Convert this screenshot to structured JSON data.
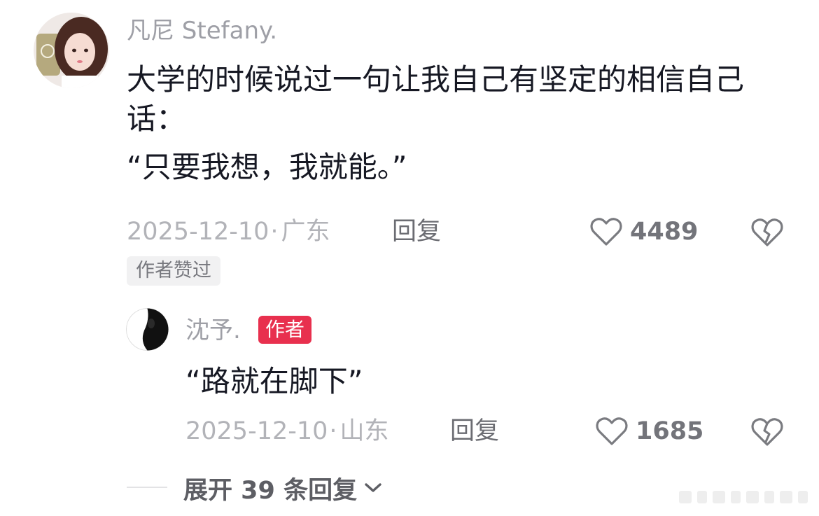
{
  "comment": {
    "author_name": "凡尼 Stefany.",
    "text_line1": "大学的时候说过一句让我自己有坚定的相信自己话：",
    "text_line2": "“只要我想，我就能。”",
    "date": "2025-12-10",
    "separator": "·",
    "location": "广东",
    "reply_label": "回复",
    "like_count": "4489",
    "author_liked_badge": "作者赞过"
  },
  "reply": {
    "author_name": "沈予.",
    "author_tag": "作者",
    "text": "“路就在脚下”",
    "date": "2025-12-10",
    "separator": "·",
    "location": "山东",
    "reply_label": "回复",
    "like_count": "1685"
  },
  "expand": {
    "label": "展开 39 条回复"
  },
  "icons": {
    "like": "heart-outline-icon",
    "dislike": "broken-heart-icon",
    "expand": "chevron-down-icon"
  },
  "colors": {
    "primary_text": "#161823",
    "secondary_text": "#9e9fa6",
    "meta_text": "#b2b3b8",
    "author_tag_bg": "#e8304e",
    "badge_bg": "#f1f1f2"
  }
}
